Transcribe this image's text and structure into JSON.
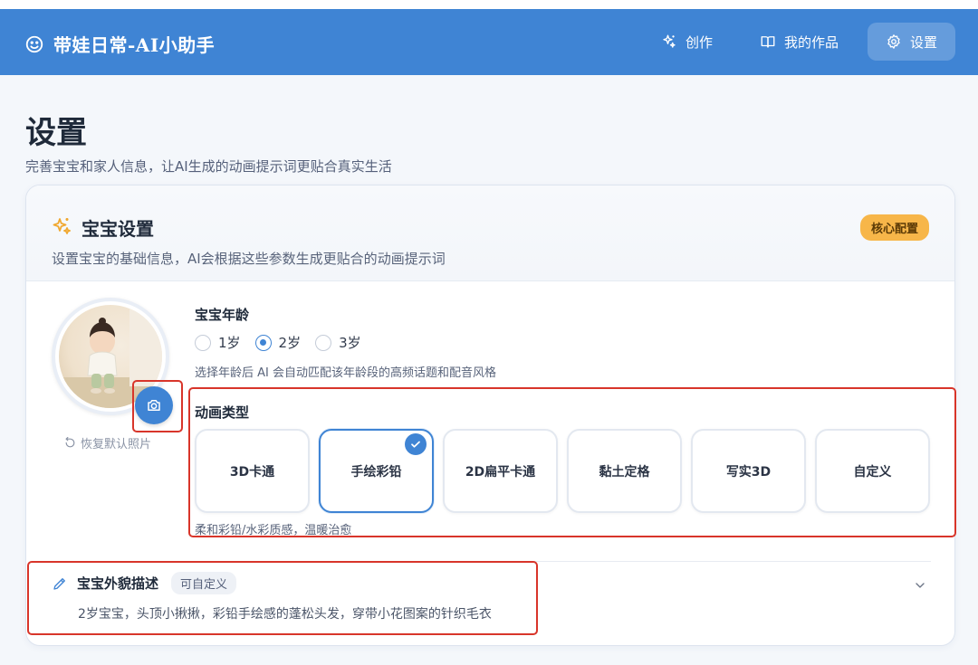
{
  "app": {
    "title": "带娃日常-AI小助手",
    "nav": [
      {
        "label": "创作",
        "icon": "sparkles-icon"
      },
      {
        "label": "我的作品",
        "icon": "book-icon"
      },
      {
        "label": "设置",
        "icon": "gear-icon",
        "active": true
      }
    ]
  },
  "page": {
    "title": "设置",
    "subtitle": "完善宝宝和家人信息，让AI生成的动画提示词更贴合真实生活"
  },
  "card": {
    "title": "宝宝设置",
    "badge": "核心配置",
    "description": "设置宝宝的基础信息，AI会根据这些参数生成更贴合的动画提示词",
    "restore_label": "恢复默认照片",
    "age": {
      "label": "宝宝年龄",
      "options": [
        "1岁",
        "2岁",
        "3岁"
      ],
      "selected": "2岁",
      "hint": "选择年龄后 AI 会自动匹配该年龄段的高频话题和配音风格"
    },
    "animation": {
      "label": "动画类型",
      "options": [
        "3D卡通",
        "手绘彩铅",
        "2D扁平卡通",
        "黏土定格",
        "写实3D",
        "自定义"
      ],
      "selected": "手绘彩铅",
      "hint": "柔和彩铅/水彩质感，温暖治愈"
    },
    "appearance": {
      "title": "宝宝外貌描述",
      "tag": "可自定义",
      "description": "2岁宝宝，头顶小揪揪，彩铅手绘感的蓬松头发，穿带小花图案的针织毛衣"
    }
  },
  "colors": {
    "primary": "#3f84d4",
    "badge": "#f7b649",
    "highlight": "#d8352a"
  }
}
